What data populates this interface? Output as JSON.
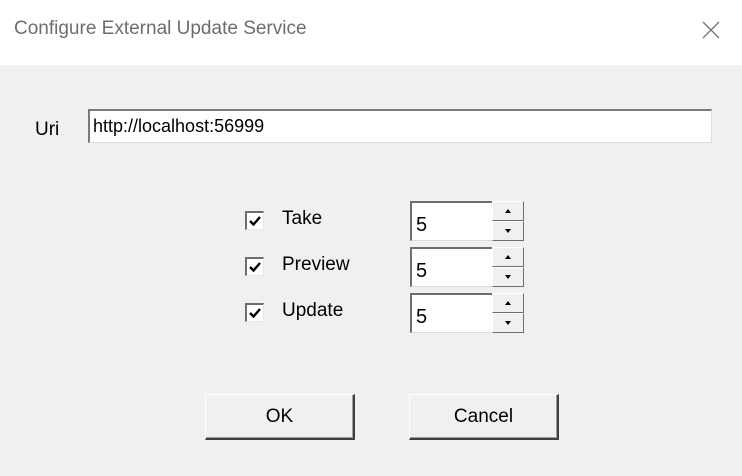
{
  "window": {
    "title": "Configure External Update Service",
    "close_icon": "close-icon"
  },
  "uri": {
    "label": "Uri",
    "value": "http://localhost:56999"
  },
  "options": [
    {
      "label": "Take",
      "checked": true,
      "value": "5"
    },
    {
      "label": "Preview",
      "checked": true,
      "value": "5"
    },
    {
      "label": "Update",
      "checked": true,
      "value": "5"
    }
  ],
  "buttons": {
    "ok": "OK",
    "cancel": "Cancel"
  },
  "colors": {
    "title_text": "#6d6d6d",
    "client_background": "#f0f0f0"
  }
}
